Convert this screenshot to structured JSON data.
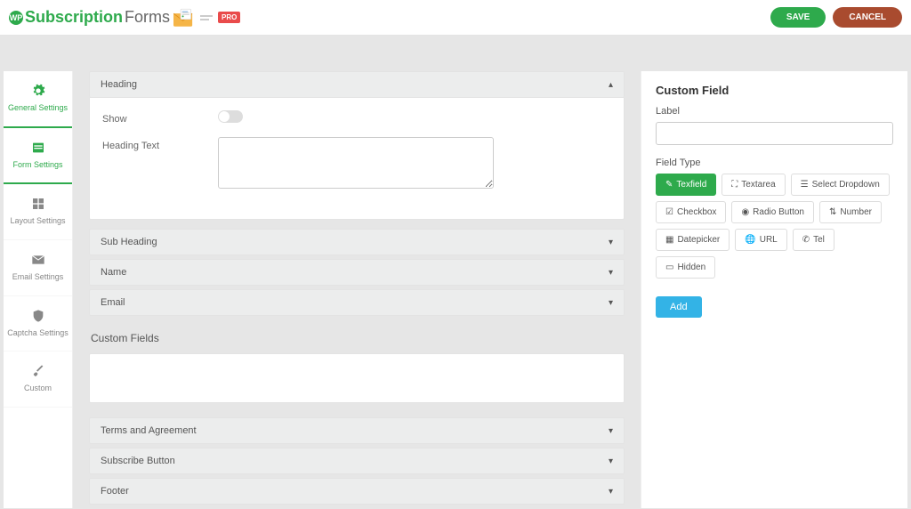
{
  "header": {
    "logo_prefix": "WP",
    "logo_word1": "Subscription",
    "logo_word2": "Forms",
    "pro": "PRO",
    "save": "SAVE",
    "cancel": "CANCEL"
  },
  "sidebar": {
    "items": [
      {
        "label": "General Settings",
        "active": true
      },
      {
        "label": "Form Settings",
        "active": true
      },
      {
        "label": "Layout Settings",
        "active": false
      },
      {
        "label": "Email Settings",
        "active": false
      },
      {
        "label": "Captcha Settings",
        "active": false
      },
      {
        "label": "Custom",
        "active": false
      }
    ]
  },
  "main": {
    "heading_accordion": "Heading",
    "show_label": "Show",
    "heading_text_label": "Heading Text",
    "heading_text_value": "",
    "collapsed": [
      "Sub Heading",
      "Name",
      "Email"
    ],
    "custom_fields_title": "Custom Fields",
    "collapsed_lower": [
      "Terms and Agreement",
      "Subscribe Button",
      "Footer"
    ]
  },
  "right": {
    "title": "Custom Field",
    "label_label": "Label",
    "label_value": "",
    "field_type_label": "Field Type",
    "types": [
      {
        "label": "Texfield",
        "active": true
      },
      {
        "label": "Textarea",
        "active": false
      },
      {
        "label": "Select Dropdown",
        "active": false
      },
      {
        "label": "Checkbox",
        "active": false
      },
      {
        "label": "Radio Button",
        "active": false
      },
      {
        "label": "Number",
        "active": false
      },
      {
        "label": "Datepicker",
        "active": false
      },
      {
        "label": "URL",
        "active": false
      },
      {
        "label": "Tel",
        "active": false
      },
      {
        "label": "Hidden",
        "active": false
      }
    ],
    "add": "Add"
  }
}
